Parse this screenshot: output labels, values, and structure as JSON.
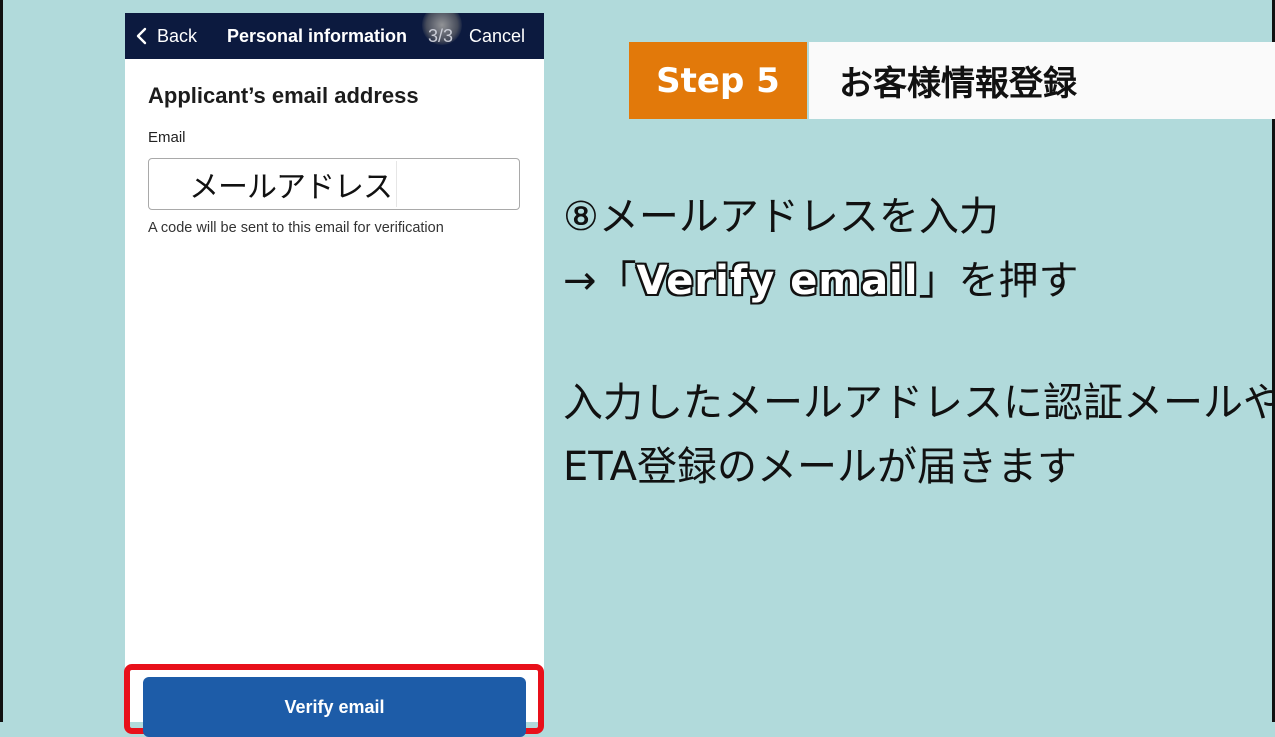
{
  "nav": {
    "back_label": "Back",
    "title": "Personal information",
    "step": "3/3",
    "cancel_label": "Cancel"
  },
  "form": {
    "section_title": "Applicant’s email address",
    "email_label": "Email",
    "email_value": "メールアドレス",
    "hint": "A code will be sent to this email for verification",
    "verify_button": "Verify email"
  },
  "step": {
    "number_label": "Step 5",
    "title": "お客様情報登録"
  },
  "instructions": {
    "line1": "⑧メールアドレスを入力",
    "line2_prefix": "→「",
    "line2_highlight": "Verify email",
    "line2_suffix": "」を押す",
    "line3": "入力したメールアドレスに認証メールや",
    "line4": "ETA登録のメールが届きます"
  },
  "colors": {
    "background": "#b1dadb",
    "navbar": "#0c1a3f",
    "step_badge": "#e2790a",
    "button": "#1d5ca8",
    "highlight": "#e8101a"
  },
  "icons": {
    "back": "chevron-left-icon"
  }
}
